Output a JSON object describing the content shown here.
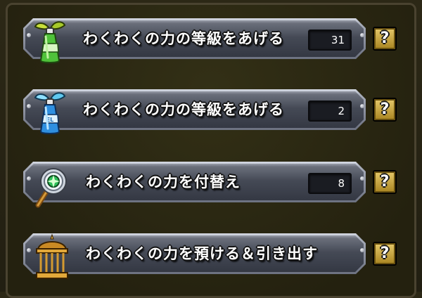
{
  "colors": {
    "background": "#27230f",
    "help_button": "#d3b142",
    "bar": "#4a4f5c"
  },
  "menu": [
    {
      "label": "わくわくの力の等級をあげる",
      "count": "31",
      "icon": "green-seed-bottle-icon"
    },
    {
      "label": "わくわくの力の等級をあげる",
      "count": "2",
      "icon": "blue-el-seed-bottle-icon"
    },
    {
      "label": "わくわくの力を付替え",
      "count": "8",
      "icon": "clover-mirror-wand-icon"
    },
    {
      "label": "わくわくの力を預ける＆引き出す",
      "count": "",
      "icon": "golden-cage-icon"
    }
  ],
  "help_label": "?"
}
